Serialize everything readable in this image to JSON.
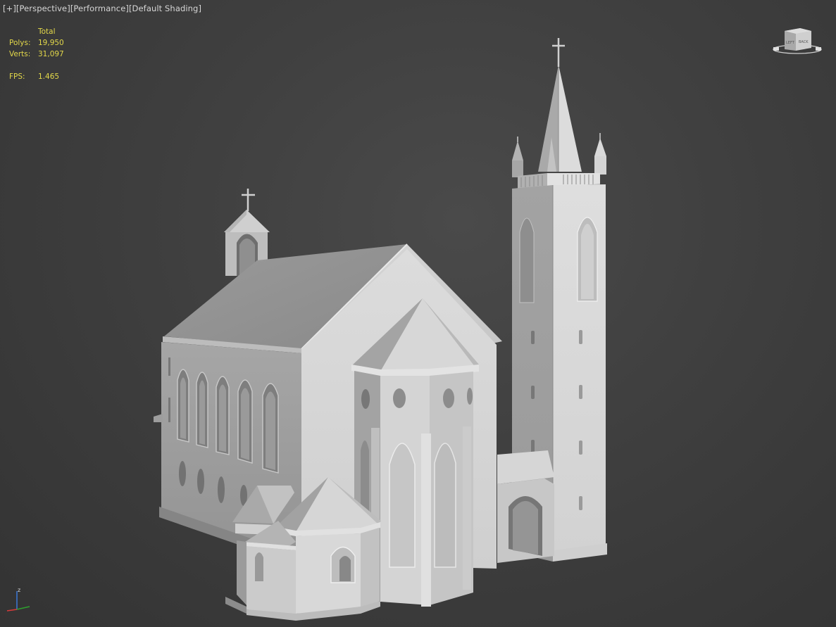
{
  "viewport": {
    "labels": [
      "[+]",
      "[Perspective]",
      "[Performance]",
      "[Default Shading]"
    ]
  },
  "stats": {
    "header": "Total",
    "polys_label": "Polys:",
    "polys_value": "19,950",
    "verts_label": "Verts:",
    "verts_value": "31,097",
    "fps_label": "FPS:",
    "fps_value": "1.465"
  },
  "viewcube": {
    "face_left": "LEFT",
    "face_back": "BACK"
  },
  "gizmo": {
    "axis_label": "z"
  },
  "colors": {
    "stats_text": "#e3d84a",
    "label_text": "#d6d6d6",
    "background": "#3a3a3a",
    "model_light": "#d9d9d9",
    "model_mid": "#b8b8b8",
    "model_dark": "#8e8e8e"
  },
  "icons": [
    "viewcube-icon",
    "axis-gizmo-icon"
  ]
}
